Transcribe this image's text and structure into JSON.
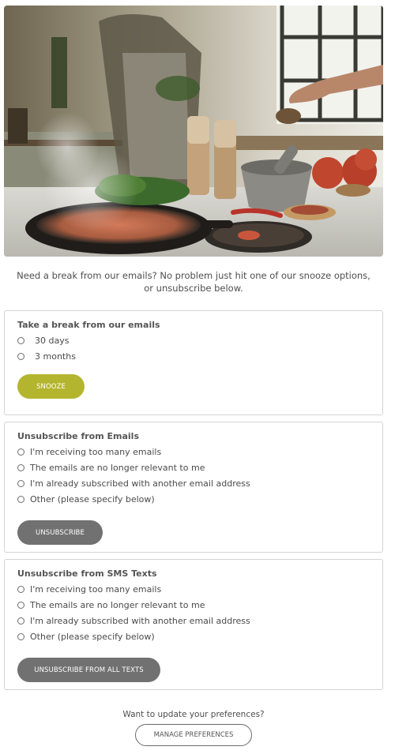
{
  "intro": {
    "text": "Need a break from our emails? No problem just hit one of our snooze options, or unsubscribe below."
  },
  "snooze": {
    "title": "Take a break from our emails",
    "options": [
      "30 days",
      "3 months"
    ],
    "button": "SNOOZE",
    "button_color": "#b4b52e"
  },
  "unsub_email": {
    "title": "Unsubscribe from Emails",
    "options": [
      "I'm receiving too many emails",
      "The emails are no longer relevant to me",
      "I'm already subscribed with another email address",
      "Other (please specify below)"
    ],
    "button": "UNSUBSCRIBE"
  },
  "unsub_sms": {
    "title": "Unsubscribe from SMS Texts",
    "options": [
      "I'm receiving too many emails",
      "The emails are no longer relevant to me",
      "I'm already subscribed with another email address",
      "Other (please specify below)"
    ],
    "button": "UNSUBSCRIBE FROM ALL TEXTS"
  },
  "preferences": {
    "question": "Want to update your preferences?",
    "button": "MANAGE PREFERENCES"
  },
  "colors": {
    "accent": "#b4b52e",
    "grey_button": "#717171"
  }
}
